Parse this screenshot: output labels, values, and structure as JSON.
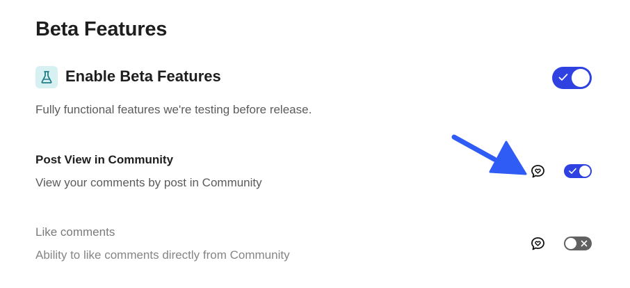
{
  "page": {
    "title": "Beta Features"
  },
  "beta": {
    "title": "Enable Beta Features",
    "description": "Fully functional features we're testing before release.",
    "enabled": true,
    "icon": "flask-icon"
  },
  "features": [
    {
      "title": "Post View in Community",
      "description": "View your comments by post in Community",
      "enabled": true,
      "icon": "chat-heart-icon"
    },
    {
      "title": "Like comments",
      "description": "Ability to like comments directly from Community",
      "enabled": false,
      "icon": "chat-heart-icon"
    }
  ],
  "colors": {
    "toggle_on": "#2f41e0",
    "toggle_off": "#616161",
    "icon_bg": "#d7f0f2",
    "icon_fg": "#1f7c86",
    "annotation_arrow": "#2f5cf5"
  }
}
